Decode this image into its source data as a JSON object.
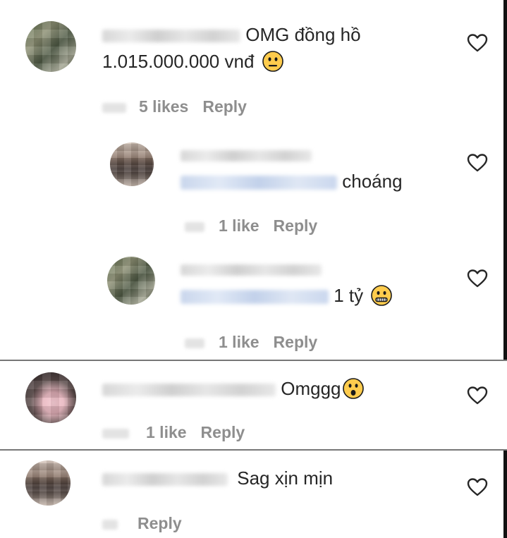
{
  "comments": [
    {
      "text_line1": "OMG đồng hồ",
      "text_line2": "1.015.000.000 vnđ",
      "emoji": "neutral-face",
      "likes": "5 likes",
      "reply": "Reply"
    },
    {
      "text": "choáng",
      "emoji": "",
      "likes": "1 like",
      "reply": "Reply"
    },
    {
      "text": "1 tỷ",
      "emoji": "zipper-mouth-face",
      "likes": "1 like",
      "reply": "Reply"
    },
    {
      "text": "Omggg",
      "emoji": "astonished-face",
      "likes": "1 like",
      "reply": "Reply"
    },
    {
      "text": "Sag xịn mịn",
      "emoji": "",
      "likes": "",
      "reply": "Reply"
    }
  ],
  "colors": {
    "text": "#262626",
    "meta": "#8e8e8e",
    "emoji_fill": "#ffcc4d"
  }
}
